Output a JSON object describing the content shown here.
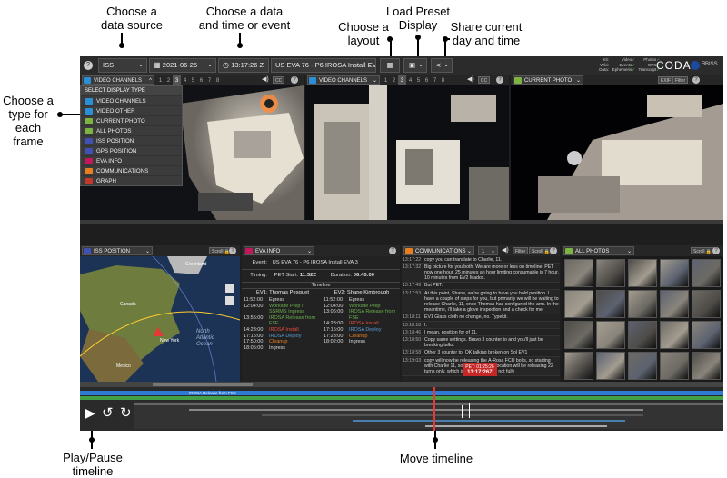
{
  "annotations": {
    "source": [
      "Choose a",
      "data source"
    ],
    "datetime": [
      "Choose a data",
      "and time or event"
    ],
    "layout": [
      "Choose a",
      "layout"
    ],
    "preset": [
      "Load Preset",
      "Display"
    ],
    "share": [
      "Share current",
      "day and time"
    ],
    "frame_type": [
      "Choose a",
      "type for",
      "each frame"
    ],
    "playpause": [
      "Play/Pause",
      "timeline"
    ],
    "move": [
      "Move timeline"
    ]
  },
  "toolbar": {
    "source": "ISS",
    "date": "2021-06-25",
    "time": "13:17:26 Z",
    "event": "US EVA 76 - P6 IROSA Install EV...",
    "brand": "CODA",
    "partner": "ƎBISS",
    "status": {
      "kit_label": "Kit:",
      "wiki_label": "Wiki:",
      "data_label": "Data:",
      "video": "Video",
      "events": "Events",
      "ephemeris": "Ephemeris",
      "photos": "Photos",
      "gps": "GPS",
      "transcript": "Transcript"
    }
  },
  "top_panels": {
    "left": {
      "title": "VIDEO CHANNELS",
      "nums": [
        "1",
        "2",
        "3",
        "4",
        "5",
        "6",
        "7",
        "8"
      ],
      "active": "3"
    },
    "middle": {
      "title": "VIDEO CHANNELS",
      "nums": [
        "1",
        "2",
        "3",
        "4",
        "5",
        "6",
        "7",
        "8"
      ],
      "active": "3"
    },
    "right": {
      "title": "CURRENT PHOTO",
      "btn1": "EXIF",
      "btn2": "Filter"
    }
  },
  "dropdown": {
    "header": "SELECT DISPLAY TYPE",
    "items": [
      {
        "label": "VIDEO CHANNELS",
        "color": "#2a8fd6"
      },
      {
        "label": "VIDEO OTHER",
        "color": "#2a8fd6"
      },
      {
        "label": "CURRENT PHOTO",
        "color": "#7cb342"
      },
      {
        "label": "ALL PHOTOS",
        "color": "#7cb342"
      },
      {
        "label": "ISS POSITION",
        "color": "#3f51b5"
      },
      {
        "label": "GPS POSITION",
        "color": "#3f51b5"
      },
      {
        "label": "EVA INFO",
        "color": "#c2185b"
      },
      {
        "label": "COMMUNICATIONS",
        "color": "#e67e22"
      },
      {
        "label": "GRAPH",
        "color": "#c0392b"
      }
    ]
  },
  "iss_panel": {
    "title": "ISS POSITION",
    "scroll": "Scroll",
    "map_labels": {
      "greenland": "Greenland",
      "canada": "Canada",
      "newyork": "New York",
      "ocean": [
        "North",
        "Atlantic",
        "Ocean"
      ],
      "mexico": "Mexico"
    }
  },
  "eva_panel": {
    "title": "EVA INFO",
    "event_label": "Event:",
    "event_value": "US EVA 76 - P6 IROSA Install EVA 3",
    "timing_label": "Timing:",
    "pet_start_label": "PET Start:",
    "pet_start": "11:52Z",
    "duration_label": "Duration:",
    "duration": "06:45:00",
    "timeline_label": "Timeline",
    "ev1_title": "EV1: Thomas Pesquet",
    "ev2_title": "EV2: Shane Kimbrough",
    "ev1": [
      {
        "t": "11:52:00",
        "s": "Egress",
        "c": "#ddd"
      },
      {
        "t": "12:04:00",
        "s": "Worksite Prep / SSRMS Ingress",
        "c": "#6ab04c"
      },
      {
        "t": "13:55:00",
        "s": "IROSA Release from FSE",
        "c": "#6ab04c"
      },
      {
        "t": "14:23:00",
        "s": "IROSA Install",
        "c": "#e74c3c"
      },
      {
        "t": "17:15:00",
        "s": "IROSA Deploy",
        "c": "#5a9bd4"
      },
      {
        "t": "17:50:00",
        "s": "Cleanup",
        "c": "#e67e22"
      },
      {
        "t": "18:05:00",
        "s": "Ingress",
        "c": "#ddd"
      }
    ],
    "ev2": [
      {
        "t": "11:52:00",
        "s": "Egress",
        "c": "#ddd"
      },
      {
        "t": "12:04:00",
        "s": "Worksite Prep",
        "c": "#6ab04c"
      },
      {
        "t": "13:06:00",
        "s": "IROSA Release from FSE",
        "c": "#6ab04c"
      },
      {
        "t": "14:23:00",
        "s": "IROSA Install",
        "c": "#e74c3c"
      },
      {
        "t": "17:15:00",
        "s": "IROSA Deploy",
        "c": "#5a9bd4"
      },
      {
        "t": "17:23:00",
        "s": "Cleanup",
        "c": "#e67e22"
      },
      {
        "t": "18:02:00",
        "s": "Ingress",
        "c": "#ddd"
      }
    ]
  },
  "comms_panel": {
    "title": "COMMUNICATIONS",
    "channel": "1",
    "filter": "Filter",
    "scroll": "Scroll",
    "lines": [
      {
        "t": "13:17:22",
        "m": "copy you can translate to Charlie, 11."
      },
      {
        "t": "13:17:32",
        "m": "Big picture for you both. We are more or less on timeline. PET now one hour, 25 minutes an hour limiting consumable is 7 hour, 10 minutes from EV2 Madox."
      },
      {
        "t": "13:17:49",
        "m": "But PET."
      },
      {
        "t": "13:17:53",
        "m": "At this point, Shane, we're going to have you hold position. I have a couple of steps for you, but primarily we will be waiting to release Charlie, 11, once Thomas has configured the arm. In the meantime, i'll take a glove inspection and a check for me."
      },
      {
        "t": "13:18:11",
        "m": "EV1 Glass cloth no change, no. Typekit."
      },
      {
        "t": "13:18:18",
        "m": "I."
      },
      {
        "t": "13:18:46",
        "m": "I mean, position for of 11."
      },
      {
        "t": "13:18:50",
        "m": "Copy same settings. Bravo 3 counter to and you'll just be breaking talks."
      },
      {
        "t": "13:18:58",
        "m": "Other 3 counter to. OK talking broken on Sol EV1"
      },
      {
        "t": "13:19:03",
        "m": "copy will now be releasing the A-Rosa FCU bolts, so starting with Charlie 11, so in your current location will be releasing 22 turns only, which is just halfway, so not fully"
      }
    ],
    "pet_badge": "PET: 01:25:26",
    "time_badge": "13:17:26Z"
  },
  "photos_panel": {
    "title": "ALL PHOTOS",
    "scroll": "Scroll"
  },
  "timeline": {
    "band_label": "IROSA Release from FSE"
  }
}
